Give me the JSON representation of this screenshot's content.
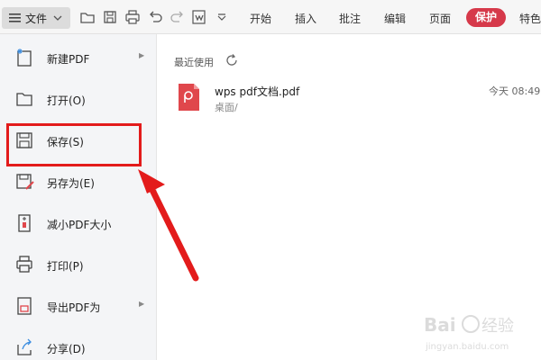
{
  "toolbar": {
    "file_label": "文件",
    "tabs": [
      "开始",
      "插入",
      "批注",
      "编辑",
      "页面",
      "保护",
      "特色"
    ]
  },
  "menu": {
    "items": [
      {
        "label": "新建PDF",
        "icon": "new-pdf-icon",
        "submenu": true
      },
      {
        "label": "打开(O)",
        "icon": "open-folder-icon",
        "submenu": false
      },
      {
        "label": "保存(S)",
        "icon": "save-icon",
        "submenu": false
      },
      {
        "label": "另存为(E)",
        "icon": "save-as-icon",
        "submenu": false
      },
      {
        "label": "减小PDF大小",
        "icon": "compress-icon",
        "submenu": false
      },
      {
        "label": "打印(P)",
        "icon": "print-icon",
        "submenu": false
      },
      {
        "label": "导出PDF为",
        "icon": "export-icon",
        "submenu": true
      },
      {
        "label": "分享(D)",
        "icon": "share-icon",
        "submenu": false
      }
    ]
  },
  "recent": {
    "title": "最近使用",
    "files": [
      {
        "name": "wps pdf文档.pdf",
        "path": "桌面/",
        "time": "今天 08:49"
      }
    ]
  },
  "watermark": {
    "text_main": "Bai 经验",
    "text_sub": "jingyan.baidu.com"
  },
  "colors": {
    "protect_tab": "#d6394a",
    "highlight": "#e31b1b",
    "arrow": "#e31b1b",
    "pdf_icon": "#e0474c"
  }
}
